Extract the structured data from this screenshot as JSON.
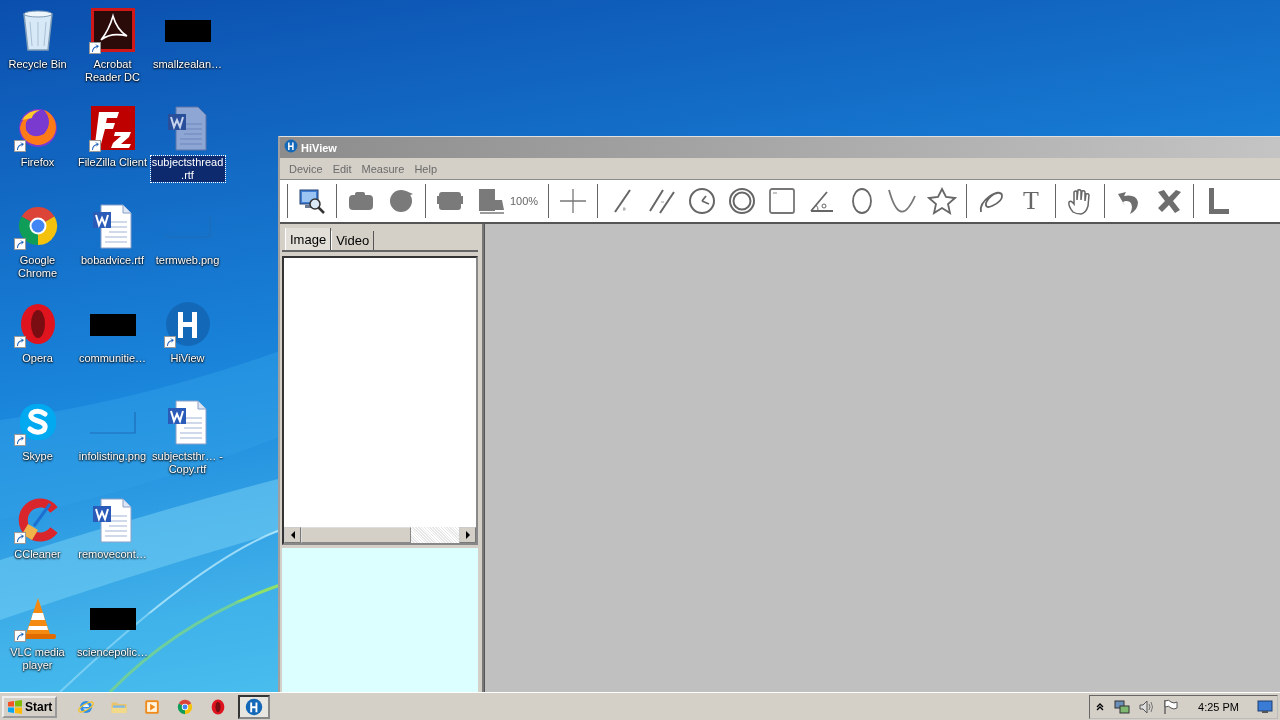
{
  "desktop": {
    "icons": [
      {
        "label": "Recycle Bin",
        "kind": "recycle-bin",
        "shortcut": false,
        "selected": false
      },
      {
        "label": "Firefox",
        "kind": "firefox",
        "shortcut": true,
        "selected": false
      },
      {
        "label": "Google Chrome",
        "kind": "chrome",
        "shortcut": true,
        "selected": false
      },
      {
        "label": "Opera",
        "kind": "opera",
        "shortcut": true,
        "selected": false
      },
      {
        "label": "Skype",
        "kind": "skype",
        "shortcut": true,
        "selected": false
      },
      {
        "label": "CCleaner",
        "kind": "ccleaner",
        "shortcut": true,
        "selected": false
      },
      {
        "label": "VLC media player",
        "kind": "vlc",
        "shortcut": true,
        "selected": false
      },
      {
        "label": "Acrobat Reader DC",
        "kind": "acrobat",
        "shortcut": true,
        "selected": false
      },
      {
        "label": "FileZilla Client",
        "kind": "filezilla",
        "shortcut": true,
        "selected": false
      },
      {
        "label": "bobadvice.rtf",
        "kind": "word",
        "shortcut": false,
        "selected": false
      },
      {
        "label": "communitie…",
        "kind": "dark-thumb",
        "shortcut": false,
        "selected": false
      },
      {
        "label": "infolisting.png",
        "kind": "blank-thumb",
        "shortcut": false,
        "selected": false
      },
      {
        "label": "removecont…",
        "kind": "word",
        "shortcut": false,
        "selected": false
      },
      {
        "label": "sciencepolic…",
        "kind": "dark-thumb",
        "shortcut": false,
        "selected": false
      },
      {
        "label": "smallzealan…",
        "kind": "dark-thumb",
        "shortcut": false,
        "selected": false
      },
      {
        "label": "subjectsthread.rtf",
        "kind": "word-faded",
        "shortcut": false,
        "selected": true
      },
      {
        "label": "termweb.png",
        "kind": "blank-thumb",
        "shortcut": false,
        "selected": false
      },
      {
        "label": "HiView",
        "kind": "hiview",
        "shortcut": true,
        "selected": false
      },
      {
        "label": "subjectsthr… - Copy.rtf",
        "kind": "word",
        "shortcut": false,
        "selected": false
      }
    ]
  },
  "window": {
    "title": "HiView",
    "menu": [
      "Device",
      "Edit",
      "Measure",
      "Help"
    ],
    "toolbar": [
      {
        "kind": "separator"
      },
      {
        "kind": "monitor-search"
      },
      {
        "kind": "separator"
      },
      {
        "kind": "camera"
      },
      {
        "kind": "record"
      },
      {
        "kind": "separator"
      },
      {
        "kind": "capture"
      },
      {
        "kind": "fit",
        "label": "100%"
      },
      {
        "kind": "separator"
      },
      {
        "kind": "crosshair"
      },
      {
        "kind": "separator"
      },
      {
        "kind": "line"
      },
      {
        "kind": "parallel"
      },
      {
        "kind": "clock"
      },
      {
        "kind": "circle"
      },
      {
        "kind": "rect"
      },
      {
        "kind": "angle"
      },
      {
        "kind": "ellipse"
      },
      {
        "kind": "arc"
      },
      {
        "kind": "star"
      },
      {
        "kind": "separator"
      },
      {
        "kind": "freehand"
      },
      {
        "kind": "text",
        "glyph": "T"
      },
      {
        "kind": "separator"
      },
      {
        "kind": "hand"
      },
      {
        "kind": "separator"
      },
      {
        "kind": "undo"
      },
      {
        "kind": "delete"
      },
      {
        "kind": "separator"
      },
      {
        "kind": "ruler"
      }
    ],
    "tabs": [
      {
        "label": "Image",
        "selected": true
      },
      {
        "label": "Video",
        "selected": false
      }
    ]
  },
  "taskbar": {
    "start": "Start",
    "apps": [
      {
        "kind": "ie",
        "active": false
      },
      {
        "kind": "folder",
        "active": false
      },
      {
        "kind": "media",
        "active": false
      },
      {
        "kind": "chrome",
        "active": false
      },
      {
        "kind": "opera",
        "active": false
      },
      {
        "kind": "hiview",
        "active": true
      }
    ],
    "clock": "4:25 PM"
  }
}
